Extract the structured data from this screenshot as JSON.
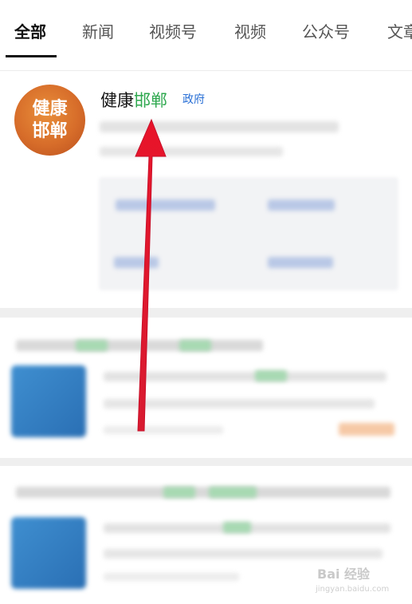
{
  "tabs": [
    {
      "label": "全部",
      "active": true
    },
    {
      "label": "新闻"
    },
    {
      "label": "视频号"
    },
    {
      "label": "视频"
    },
    {
      "label": "公众号"
    },
    {
      "label": "文章"
    }
  ],
  "account": {
    "logo_text": "健康邯郸",
    "name_plain": "健康",
    "name_highlight": "邯郸",
    "tag": "政府"
  },
  "colors": {
    "highlight": "#2fa84f",
    "tag": "#2a70d6",
    "arrow": "#e21b2d"
  },
  "watermark": {
    "text": "Bai 经验",
    "url": "jingyan.baidu.com"
  }
}
